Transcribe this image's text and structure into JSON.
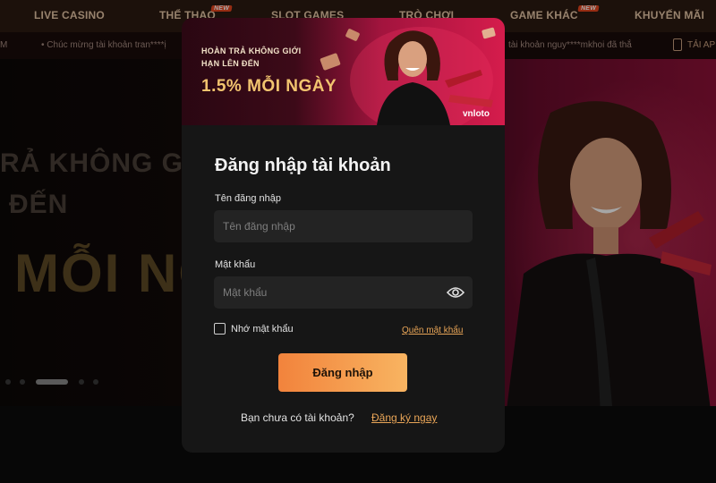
{
  "nav": {
    "items": [
      {
        "label": "LIVE CASINO",
        "badge": ""
      },
      {
        "label": "THỂ THAO",
        "badge": "NEW"
      },
      {
        "label": "SLOT GAMES",
        "badge": ""
      },
      {
        "label": "TRÒ CHƠI",
        "badge": ""
      },
      {
        "label": "GAME KHÁC",
        "badge": "NEW"
      },
      {
        "label": "KHUYẾN MÃI",
        "badge": ""
      }
    ]
  },
  "ticker": {
    "left": "M",
    "message_1": "• Chúc mừng tài khoản tran****ị",
    "message_2": "tài khoản nguy****mkhoi đã thắ",
    "right_label": "TẢI AP",
    "icon": "phone-icon"
  },
  "hero": {
    "line1": "RẢ KHÔNG GIỚ",
    "line2": "ĐẾN",
    "line3": "MỖI NG",
    "slides": 5,
    "active_slide": 3
  },
  "login_modal": {
    "banner": {
      "line1": "HOÀN TRẢ KHÔNG GIỚI",
      "line2": "HẠN LÊN ĐẾN",
      "headline": "1.5% MỖI NGÀY",
      "logo": "vnloto"
    },
    "title": "Đăng nhập tài khoản",
    "username": {
      "label": "Tên đăng nhập",
      "placeholder": "Tên đăng nhập",
      "value": ""
    },
    "password": {
      "label": "Mật khẩu",
      "placeholder": "Mật khẩu",
      "value": "",
      "toggle_icon": "eye-icon"
    },
    "remember_label": "Nhớ mật khẩu",
    "remember_checked": false,
    "forgot_label": "Quên mật khẩu",
    "submit_label": "Đăng nhập",
    "signup_prompt": "Bạn chưa có tài khoản?",
    "signup_link": "Đăng ký ngay"
  },
  "colors": {
    "accent": "#f8b461",
    "accent_dark": "#f2833c",
    "link": "#e9a557",
    "modal_bg": "#161616",
    "field_bg": "#232323"
  }
}
